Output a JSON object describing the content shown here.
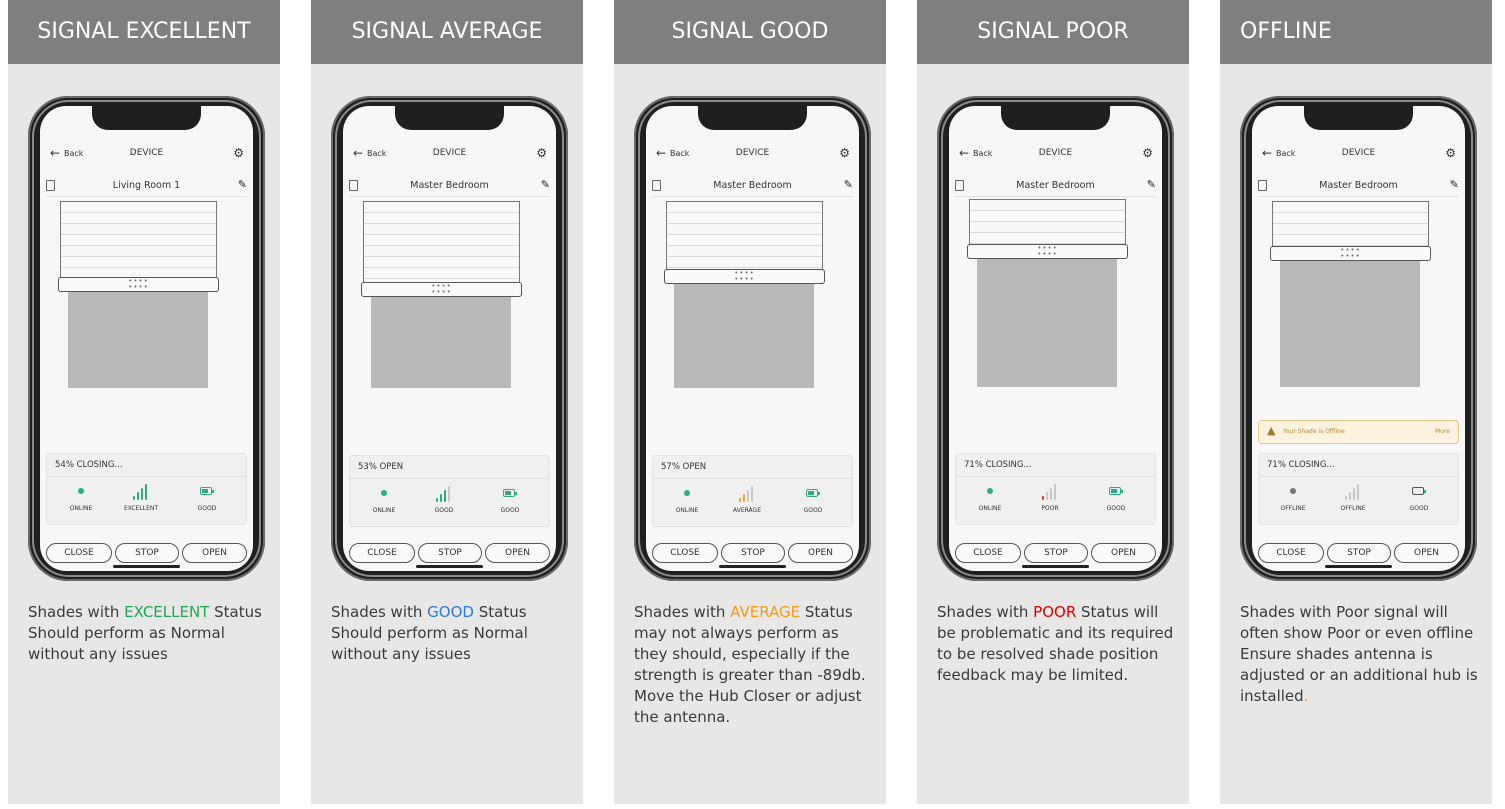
{
  "panels": [
    {
      "header": "SIGNAL EXCELLENT",
      "app": {
        "back": "Back",
        "title": "DEVICE",
        "room": "Living Room 1",
        "progress": "54% CLOSING...",
        "online_label": "ONLINE",
        "signal_label": "EXCELLENT",
        "battery_label": "GOOD",
        "close": "CLOSE",
        "stop": "STOP",
        "open": "OPEN"
      },
      "desc": {
        "pre": "Shades with ",
        "highlight": "EXCELLENT",
        "post": " Status Should perform as Normal without any issues"
      }
    },
    {
      "header": "SIGNAL AVERAGE",
      "app": {
        "back": "Back",
        "title": "DEVICE",
        "room": "Master Bedroom",
        "progress": "53% OPEN",
        "online_label": "ONLINE",
        "signal_label": "GOOD",
        "battery_label": "GOOD",
        "close": "CLOSE",
        "stop": "STOP",
        "open": "OPEN"
      },
      "desc": {
        "pre": "Shades with ",
        "highlight": "GOOD",
        "post": " Status Should perform as Normal without any issues"
      }
    },
    {
      "header": "SIGNAL GOOD",
      "app": {
        "back": "Back",
        "title": "DEVICE",
        "room": "Master Bedroom",
        "progress": "57% OPEN",
        "online_label": "ONLINE",
        "signal_label": "AVERAGE",
        "battery_label": "GOOD",
        "close": "CLOSE",
        "stop": "STOP",
        "open": "OPEN"
      },
      "desc": {
        "pre": "Shades with ",
        "highlight": "AVERAGE",
        "post": " Status may not always perform as they should, especially if the strength is greater than -89db. Move the Hub Closer or adjust the antenna."
      }
    },
    {
      "header": "SIGNAL POOR",
      "app": {
        "back": "Back",
        "title": "DEVICE",
        "room": "Master Bedroom",
        "progress": "71% CLOSING...",
        "online_label": "ONLINE",
        "signal_label": "POOR",
        "battery_label": "GOOD",
        "close": "CLOSE",
        "stop": "STOP",
        "open": "OPEN"
      },
      "desc": {
        "pre": "Shades with ",
        "highlight": "POOR",
        "post": " Status will be problematic and its required to be resolved shade position feedback may be limited."
      }
    },
    {
      "header": "OFFLINE",
      "app": {
        "back": "Back",
        "title": "DEVICE",
        "room": "Master Bedroom",
        "warning": "Your Shade is Offline",
        "warning_more": "More",
        "progress": "71% CLOSING...",
        "online_label": "OFFLINE",
        "signal_label": "OFFLINE",
        "battery_label": "GOOD",
        "close": "CLOSE",
        "stop": "STOP",
        "open": "OPEN"
      },
      "desc": {
        "pre": "Shades with Poor signal will often show Poor or even offline Ensure shades antenna is adjusted or an additional hub is installed",
        "highlight": "",
        "post": "",
        "trailing": "."
      }
    }
  ],
  "colors": {
    "header_bg": "#7f7f7f",
    "panel_bg": "#e7e7e8",
    "excellent": "#1fa84f",
    "good": "#2e7bd1",
    "average": "#f39c12",
    "poor": "#e00000",
    "online_dot": "#2dab82",
    "offline_dot": "#777777",
    "signal_bar": "#2dab82",
    "signal_bar_inactive": "#c8c8c8",
    "signal_average": "#e8a33a",
    "signal_poor": "#e03030"
  },
  "icons": {
    "back": "left-arrow-icon",
    "settings": "gear-icon",
    "edit": "pencil-icon",
    "doc": "document-icon",
    "warning": "warning-triangle-icon",
    "status": "status-dot-icon",
    "signal": "signal-bars-icon",
    "battery": "battery-icon"
  }
}
